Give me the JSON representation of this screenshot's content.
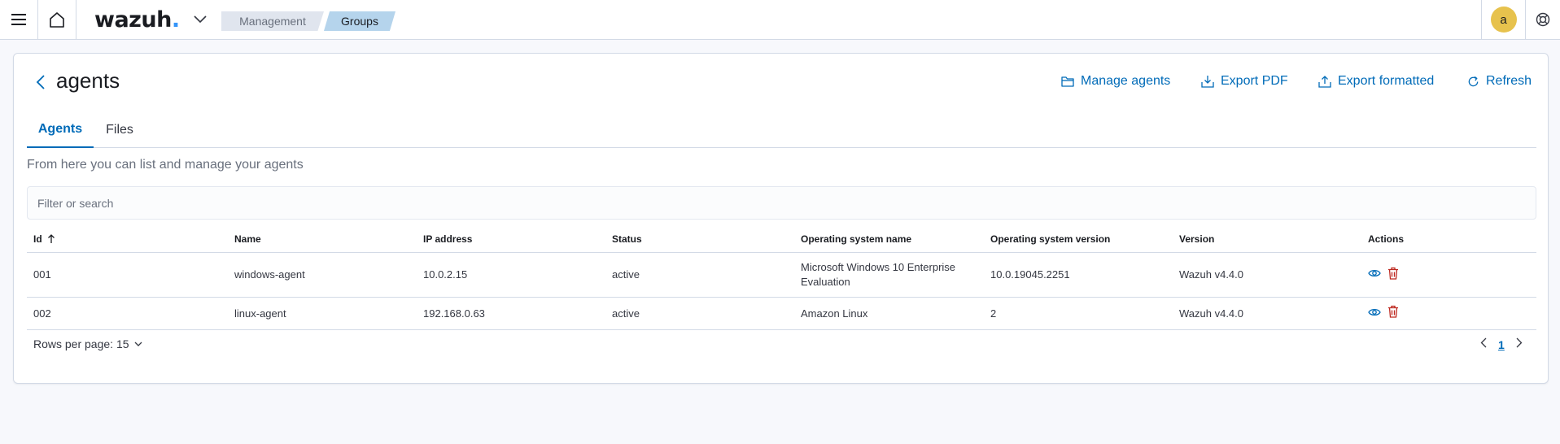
{
  "header": {
    "logo_text": "wazuh",
    "logo_dot": ".",
    "breadcrumbs": [
      "Management",
      "Groups"
    ],
    "avatar_letter": "a"
  },
  "page": {
    "title": "agents",
    "actions": {
      "manage_agents": "Manage agents",
      "export_pdf": "Export PDF",
      "export_formatted": "Export formatted",
      "refresh": "Refresh"
    },
    "tabs": [
      "Agents",
      "Files"
    ],
    "active_tab": "Agents",
    "description": "From here you can list and manage your agents",
    "search": {
      "placeholder": "Filter or search",
      "value": ""
    }
  },
  "table": {
    "columns": [
      "Id",
      "Name",
      "IP address",
      "Status",
      "Operating system name",
      "Operating system version",
      "Version",
      "Actions"
    ],
    "sorted_column": "Id",
    "sort_direction": "ascending",
    "rows": [
      {
        "id": "001",
        "name": "windows-agent",
        "ip": "10.0.2.15",
        "status": "active",
        "os_name": "Microsoft Windows 10 Enterprise Evaluation",
        "os_version": "10.0.19045.2251",
        "version": "Wazuh v4.4.0"
      },
      {
        "id": "002",
        "name": "linux-agent",
        "ip": "192.168.0.63",
        "status": "active",
        "os_name": "Amazon Linux",
        "os_version": "2",
        "version": "Wazuh v4.4.0"
      }
    ]
  },
  "pagination": {
    "rows_per_page_label": "Rows per page: 15",
    "current_page": "1"
  },
  "colors": {
    "accent": "#006bb8",
    "danger": "#bd271e",
    "avatar": "#e7c24d",
    "logo_dot": "#3595f9"
  },
  "icons": [
    "menu-icon",
    "home-icon",
    "chevron-down-icon",
    "help-icon",
    "arrow-left-icon",
    "folder-icon",
    "export-pdf-icon",
    "export-icon",
    "refresh-icon",
    "sort-ascending-icon",
    "eye-icon",
    "trash-icon",
    "chevron-left-icon",
    "chevron-right-icon"
  ]
}
